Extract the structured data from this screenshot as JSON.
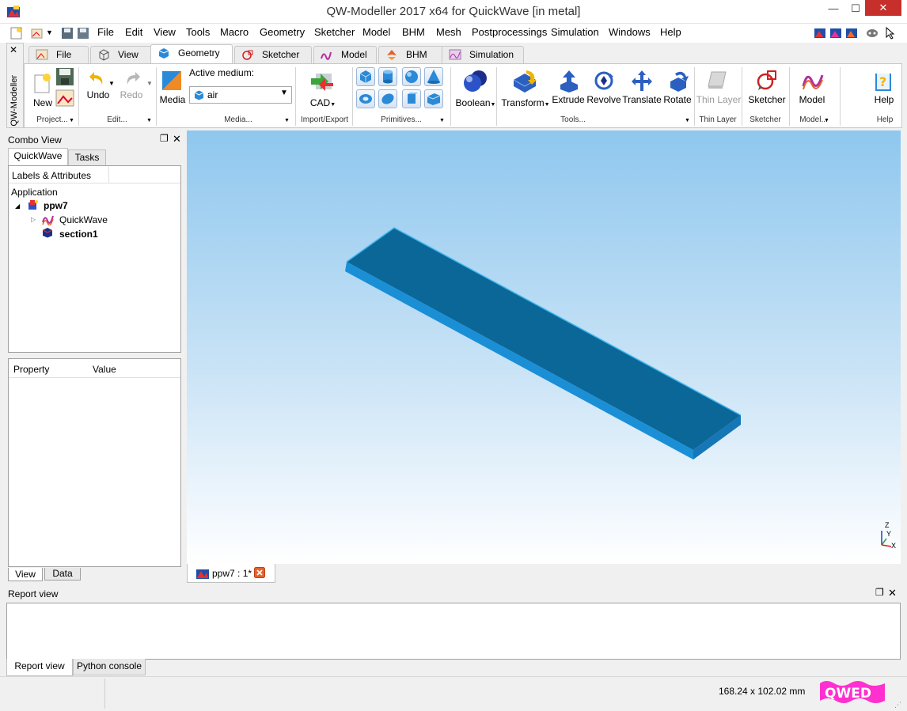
{
  "window": {
    "title": "QW-Modeller 2017 x64 for QuickWave [in metal]",
    "minimize_glyph": "—",
    "maximize_glyph": "☐",
    "close_glyph": "✕"
  },
  "menu": {
    "items": [
      "File",
      "Edit",
      "View",
      "Tools",
      "Macro",
      "Geometry",
      "Sketcher",
      "Model",
      "BHM",
      "Mesh",
      "Postprocessings",
      "Simulation",
      "Windows",
      "Help"
    ]
  },
  "side_strip": {
    "close_glyph": "✕",
    "label": "QW-Modeller"
  },
  "ribbon": {
    "tabs": [
      {
        "label": "File",
        "icon": "file-tab-icon"
      },
      {
        "label": "View",
        "icon": "view-cube-icon"
      },
      {
        "label": "Geometry",
        "icon": "geometry-cube-icon",
        "active": true
      },
      {
        "label": "Sketcher",
        "icon": "sketcher-icon"
      },
      {
        "label": "Model",
        "icon": "model-icon"
      },
      {
        "label": "BHM",
        "icon": "bhm-icon"
      },
      {
        "label": "Simulation",
        "icon": "simulation-icon"
      }
    ],
    "buttons": {
      "new": "New",
      "undo": "Undo",
      "redo": "Redo",
      "media": "Media",
      "active_medium_label": "Active medium:",
      "active_medium_value": "air",
      "cad": "CAD",
      "boolean": "Boolean",
      "transform": "Transform",
      "extrude": "Extrude",
      "revolve": "Revolve",
      "translate": "Translate",
      "rotate": "Rotate",
      "thin_layer": "Thin Layer",
      "sketcher": "Sketcher",
      "model": "Model",
      "help": "Help"
    },
    "groups": {
      "project": "Project...",
      "edit": "Edit...",
      "media": "Media...",
      "import_export": "Import/Export",
      "primitives": "Primitives...",
      "tools": "Tools...",
      "thin_layer": "Thin Layer",
      "sketcher": "Sketcher",
      "model": "Model...",
      "help": "Help"
    }
  },
  "combo": {
    "title": "Combo View",
    "tabs": [
      "QuickWave",
      "Tasks"
    ],
    "tree_header": "Labels & Attributes",
    "tree_root": "Application",
    "tree": {
      "project": "ppw7",
      "child1": "QuickWave",
      "child2": "section1"
    },
    "prop_headers": [
      "Property",
      "Value"
    ],
    "bottom_tabs": [
      "View",
      "Data"
    ]
  },
  "viewport": {
    "doc_tab": "ppw7 : 1*",
    "axes": {
      "z": "Z",
      "y": "Y",
      "x": "X"
    },
    "colors": {
      "top": "#0b6797",
      "side_light": "#1a8fd6",
      "side_dark": "#1577b5",
      "edge": "#3fb8f0"
    }
  },
  "report": {
    "title": "Report view",
    "tabs": [
      "Report view",
      "Python console"
    ]
  },
  "status": {
    "dimensions": "168.24 x 102.02 mm",
    "logo": "QWED",
    "logo_color": "#ff2fd0"
  }
}
